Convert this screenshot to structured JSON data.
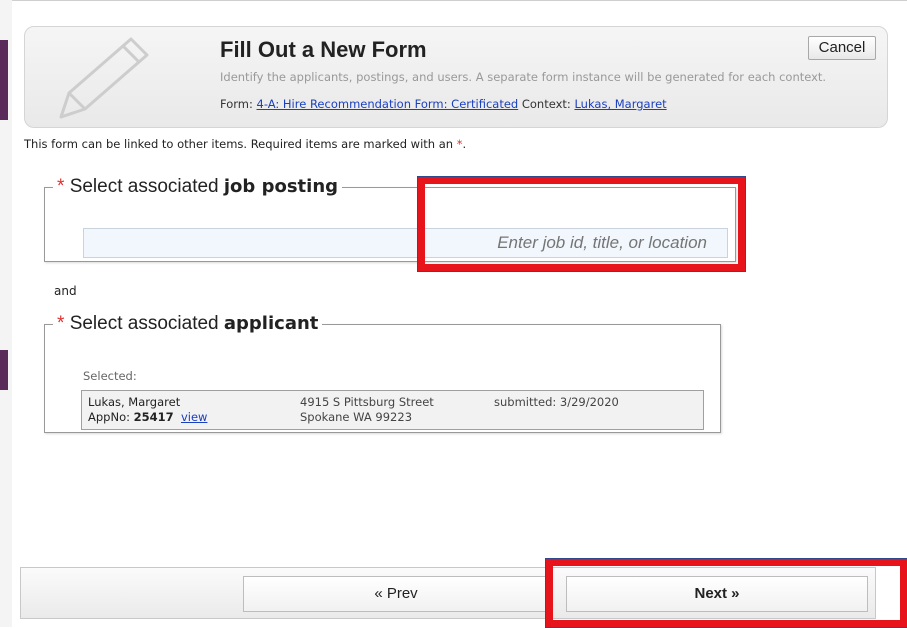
{
  "header": {
    "title": "Fill Out a New Form",
    "subtitle": "Identify the applicants, postings, and users. A separate form instance will be generated for each context.",
    "form_label": "Form:",
    "form_link": "4-A: Hire Recommendation Form: Certificated",
    "context_label": "Context:",
    "context_link": "Lukas, Margaret",
    "cancel_label": "Cancel"
  },
  "note": {
    "text": "This form can be linked to other items. Required items are marked with an",
    "required_marker": "*",
    "end": "."
  },
  "job_posting": {
    "legend_prefix": "Select associated",
    "legend_bold": "job posting",
    "placeholder": "Enter job id, title, or location"
  },
  "and_text": "and",
  "applicant": {
    "legend_prefix": "Select associated",
    "legend_bold": "applicant",
    "selected_label": "Selected:",
    "name": "Lukas, Margaret",
    "appno_label": "AppNo:",
    "appno": "25417",
    "view_link": "view",
    "street": "4915 S Pittsburg Street",
    "city": "Spokane WA 99223",
    "submitted": "submitted: 3/29/2020"
  },
  "footer": {
    "prev_label": "« Prev",
    "next_label": "Next »"
  },
  "colors": {
    "required": "#e03030",
    "link": "#1a3fbf",
    "highlight": "#e8141c"
  }
}
